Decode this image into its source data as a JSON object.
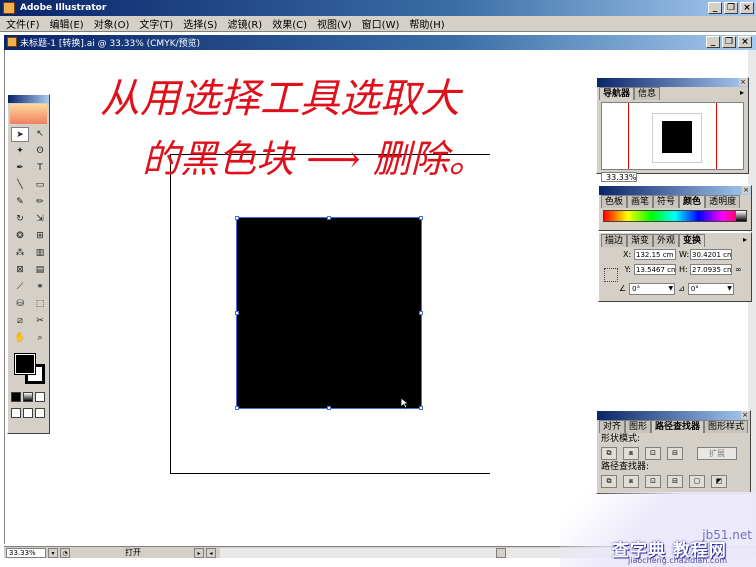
{
  "app": {
    "title": "Adobe Illustrator"
  },
  "menu": [
    "文件(F)",
    "编辑(E)",
    "对象(O)",
    "文字(T)",
    "选择(S)",
    "滤镜(R)",
    "效果(C)",
    "视图(V)",
    "窗口(W)",
    "帮助(H)"
  ],
  "document": {
    "title": "未标题-1 [转换].ai @ 33.33% (CMYK/预览)"
  },
  "annotation": {
    "line1": "从用选择工具选取大",
    "line2": "的黑色块 ⟶ 删除。",
    "color": "#e0101a"
  },
  "navigator_panel": {
    "tabs": [
      "导航器",
      "信息"
    ],
    "zoom": "33.33%"
  },
  "color_panel": {
    "tabs": [
      "色板",
      "画笔",
      "符号",
      "颜色",
      "透明度"
    ]
  },
  "transform_panel": {
    "tabs": [
      "描边",
      "渐变",
      "外观",
      "变换"
    ],
    "x": "132.15 cm",
    "y": "13.5467 cm",
    "w": "30.4201 cm",
    "h": "27.0935 cm",
    "x_label": "X:",
    "y_label": "Y:",
    "w_label": "W:",
    "h_label": "H:",
    "rotate": "0°",
    "shear": "0°"
  },
  "pathfinder_panel": {
    "tabs": [
      "对齐",
      "图形",
      "路径查找器",
      "图形样式"
    ],
    "shape_modes_label": "形状模式:",
    "expand_button": "扩展",
    "pathfinders_label": "路径查找器:"
  },
  "status_bar": {
    "zoom": "33.33%",
    "text": "打开"
  },
  "watermark": {
    "site": "jb51.net",
    "cn": "查字典 教程网",
    "url": "jiaocheng.chazidian.com"
  },
  "colors": {
    "titlebar": "#0a246a",
    "chrome": "#d4d0c8",
    "selection": "#4a70d8",
    "fill": "#000000"
  }
}
